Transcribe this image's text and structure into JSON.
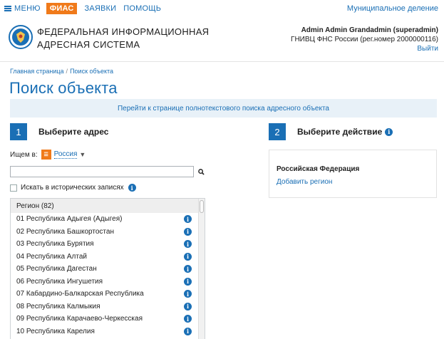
{
  "topnav": {
    "menu_label": "МЕНЮ",
    "items": [
      {
        "label": "ФИАС",
        "active": true
      },
      {
        "label": "ЗАЯВКИ",
        "active": false
      },
      {
        "label": "ПОМОЩЬ",
        "active": false
      }
    ],
    "right_link": "Муниципальное деление"
  },
  "header": {
    "title_line1": "ФЕДЕРАЛЬНАЯ ИНФОРМАЦИОННАЯ",
    "title_line2": "АДРЕСНАЯ СИСТЕМА",
    "user_name": "Admin Admin Grandadmin (superadmin)",
    "user_org": "ГНИВЦ ФНС России (рег.номер 2000000116)",
    "logout_label": "Выйти"
  },
  "breadcrumb": {
    "home": "Главная страница",
    "separator": "/",
    "current": "Поиск объекта"
  },
  "page_title": "Поиск объекта",
  "banner_text": "Перейти к странице полнотекстового поиска адресного объекта",
  "step1": {
    "number": "1",
    "label": "Выберите адрес"
  },
  "step2": {
    "number": "2",
    "label": "Выберите действие"
  },
  "search": {
    "searching_in_label": "Ищем в:",
    "region_selected": "Россия",
    "input_value": "",
    "historical_label": "Искать в исторических записях"
  },
  "region_list": {
    "header": "Регион (82)",
    "items": [
      "01 Республика Адыгея (Адыгея)",
      "02 Республика Башкортостан",
      "03 Республика Бурятия",
      "04 Республика Алтай",
      "05 Республика Дагестан",
      "06 Республика Ингушетия",
      "07 Кабардино-Балкарская Республика",
      "08 Республика Калмыкия",
      "09 Республика Карачаево-Черкесская",
      "10 Республика Карелия"
    ]
  },
  "action_panel": {
    "title": "Российская Федерация",
    "link": "Добавить регион"
  },
  "colors": {
    "accent": "#1a6fb5",
    "active_tab": "#f07a1a",
    "banner_bg": "#e8f1f8"
  },
  "icons": {
    "menu": "hamburger-icon",
    "emblem": "fns-emblem-icon",
    "info": "info-icon",
    "search": "search-icon",
    "chevron": "chevron-down-icon",
    "flag": "russia-flag-icon"
  }
}
